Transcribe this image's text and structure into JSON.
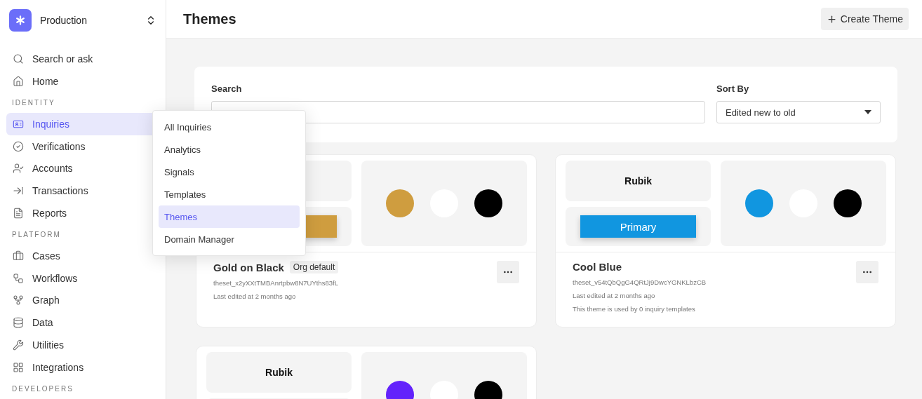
{
  "workspace": {
    "name": "Production"
  },
  "sidebar": {
    "items": [
      {
        "label": "Search or ask",
        "selected": false
      },
      {
        "label": "Home",
        "selected": false
      }
    ],
    "sections": [
      {
        "title": "IDENTITY",
        "items": [
          {
            "label": "Inquiries",
            "selected": true
          },
          {
            "label": "Verifications",
            "selected": false
          },
          {
            "label": "Accounts",
            "selected": false
          },
          {
            "label": "Transactions",
            "selected": false
          },
          {
            "label": "Reports",
            "selected": false
          }
        ]
      },
      {
        "title": "PLATFORM",
        "items": [
          {
            "label": "Cases",
            "selected": false
          },
          {
            "label": "Workflows",
            "selected": false
          },
          {
            "label": "Graph",
            "selected": false
          },
          {
            "label": "Data",
            "selected": false
          },
          {
            "label": "Utilities",
            "selected": false
          },
          {
            "label": "Integrations",
            "selected": false
          }
        ]
      },
      {
        "title": "DEVELOPERS"
      }
    ]
  },
  "menu": {
    "items": [
      {
        "label": "All Inquiries",
        "selected": false
      },
      {
        "label": "Analytics",
        "selected": false
      },
      {
        "label": "Signals",
        "selected": false
      },
      {
        "label": "Templates",
        "selected": false
      },
      {
        "label": "Themes",
        "selected": true
      },
      {
        "label": "Domain Manager",
        "selected": false
      }
    ]
  },
  "header": {
    "title": "Themes",
    "create_button": "Create Theme"
  },
  "filters": {
    "search": {
      "label": "Search"
    },
    "sort": {
      "label": "Sort By",
      "value": "Edited new to old"
    }
  },
  "themes": [
    {
      "name": "Gold on Black",
      "badge": "Org default",
      "id": "theset_x2yXXtTMBAnrtpbw8N7UYths83fL",
      "edited": "Last edited at 2 months ago",
      "button": {
        "color": "#cf9d3f"
      },
      "colors": [
        {
          "color": "#cf9d3f"
        },
        {
          "color": "#ffffff"
        },
        {
          "color": "#000000"
        }
      ]
    },
    {
      "name": "Cool Blue",
      "id": "theset_v54tQbQgG4QRtJj9DwcYGNKLbzCB",
      "edited": "Last edited at 2 months ago",
      "usage": "This theme is used by 0 inquiry templates",
      "font": "Rubik",
      "button": {
        "label": "Primary",
        "color": "#1196e0"
      },
      "colors": [
        {
          "color": "#1196e0"
        },
        {
          "color": "#ffffff"
        },
        {
          "color": "#000000"
        }
      ]
    },
    {
      "font": "Rubik",
      "colors": [
        {
          "color": "#6322fb"
        },
        {
          "color": "#ffffff"
        },
        {
          "color": "#000000"
        }
      ]
    }
  ]
}
